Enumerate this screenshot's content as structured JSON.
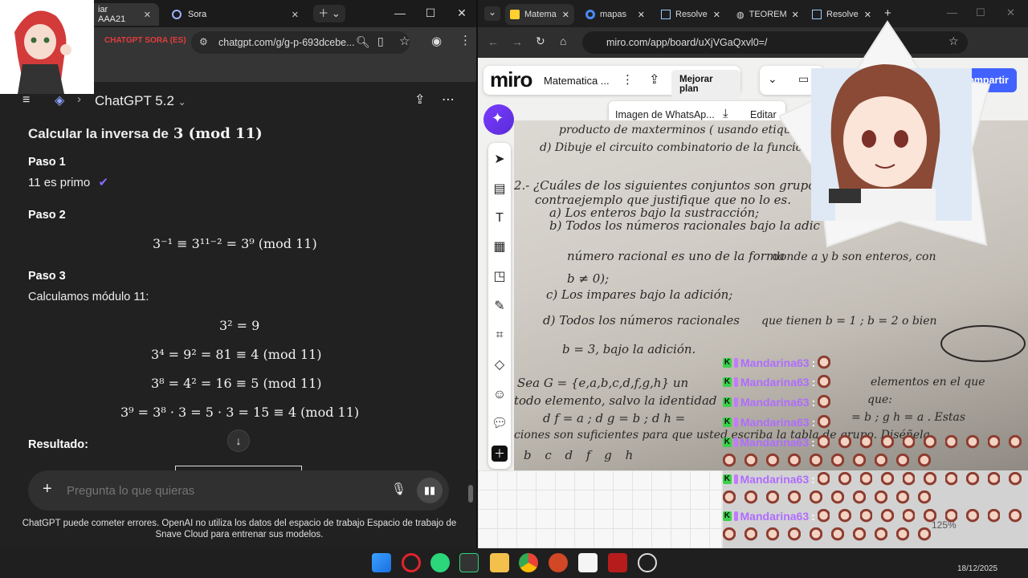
{
  "left_browser": {
    "tabs": [
      {
        "label": "iar AAA21"
      },
      {
        "label": "Sora"
      }
    ],
    "url": "chatgpt.com/g/g-p-693dcebe...",
    "overlay_text": "CHATGPT SORA (ES)",
    "header": {
      "model": "ChatGPT 5.2"
    },
    "content": {
      "title": "Calcular la inversa de",
      "title_math": "3  (mod 11)",
      "step1": {
        "label": "Paso 1",
        "text": "11 es primo"
      },
      "step2": {
        "label": "Paso 2",
        "eq": "3⁻¹ ≡ 3¹¹⁻² = 3⁹    (mod 11)"
      },
      "step3": {
        "label": "Paso 3",
        "text": "Calculamos módulo 11:",
        "eqs": [
          "3² = 9",
          "3⁴ = 9² = 81 ≡ 4    (mod 11)",
          "3⁸ = 4² = 16 ≡ 5    (mod 11)",
          "3⁹ = 3⁸ · 3 = 5 · 3 = 15 ≡ 4    (mod 11)"
        ]
      },
      "result_label": "Resultado:"
    },
    "input": {
      "placeholder": "Pregunta lo que quieras"
    },
    "disclaimer": "ChatGPT puede cometer errores. OpenAI no utiliza los datos del espacio de trabajo Espacio de trabajo de Snave Cloud para entrenar sus modelos."
  },
  "right_browser": {
    "tabs": [
      {
        "label": "Matema"
      },
      {
        "label": "mapas"
      },
      {
        "label": "Resolve"
      },
      {
        "label": "TEOREM"
      },
      {
        "label": "Resolve"
      }
    ],
    "url": "miro.com/app/board/uXjVGaQxvl0=/",
    "miro": {
      "logo": "miro",
      "board_name": "Matematica ...",
      "upgrade_label": "Mejorar plan",
      "share_label": "Compartir",
      "image_name": "Imagen de WhatsAp...",
      "edit_label": "Editar",
      "zoom": "125%"
    },
    "paper_lines": [
      "producto de maxterminos ( usando etiquetas",
      "d)  Dibuje el circuito combinatorio de la función s",
      "2.- ¿Cuáles de los siguientes conjuntos son grupos?. S",
      "contraejemplo que justifique que no lo es.",
      "a)  Los enteros bajo la sustracción;",
      "b)  Todos los números racionales bajo la adic",
      "número racional es uno de la forma",
      "donde a y b son enteros, con",
      "b ≠ 0);",
      "c)  Los impares bajo la adición;",
      "d)  Todos los números racionales",
      "que tienen b = 1   ;  b = 2  o bien",
      "b = 3,  bajo la adición.",
      "Sea G = {e,a,b,c,d,f,g,h}  un",
      "elementos en el que",
      "todo elemento, salvo la identidad",
      "que:",
      "d f = a  ;   d g = b  ;  d h =",
      "= b  ;  g h = a .  Estas",
      "ciones son suficientes para que usted escriba la tabla de grupo. Diséñela",
      "b   c   d   f   g   h"
    ]
  },
  "chat_overlay": {
    "username": "Mandarina63"
  },
  "taskbar": {
    "time": "",
    "date": "18/12/2025"
  }
}
